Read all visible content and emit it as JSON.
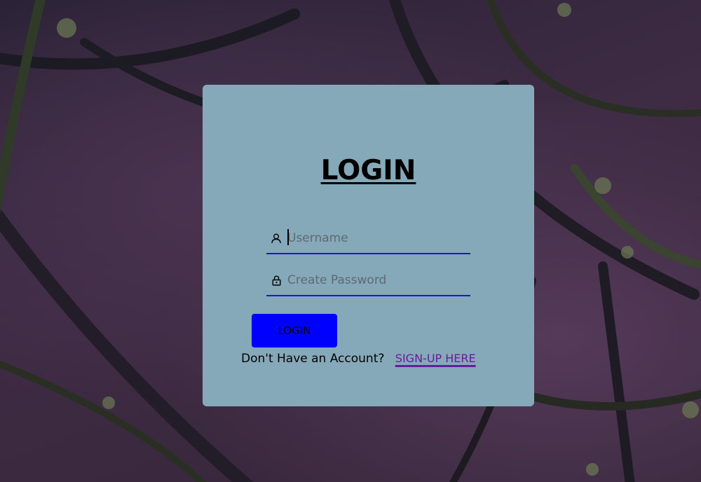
{
  "login_card": {
    "title": "LOGIN",
    "username": {
      "placeholder": "Username",
      "value": "",
      "icon": "user-icon"
    },
    "password": {
      "placeholder": "Create Password",
      "value": "",
      "icon": "lock-icon"
    },
    "login_button_label": "LOGIN",
    "signup_prompt": "Don't Have an Account?",
    "signup_link": "SIGN-UP HERE"
  },
  "colors": {
    "card_bg": "#86a9b9",
    "button_bg": "#0000ff",
    "input_underline": "#1a14e0",
    "link": "#6a1b9a"
  }
}
